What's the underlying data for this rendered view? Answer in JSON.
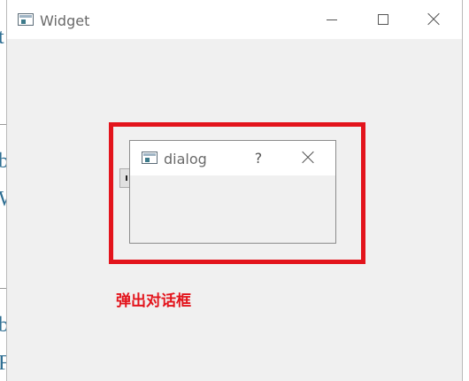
{
  "widget_window": {
    "title": "Widget",
    "icon": "app-window-icon"
  },
  "dialog": {
    "title": "dialog",
    "help_label": "?",
    "icon": "app-window-icon"
  },
  "annotation": {
    "text": "弹出对话框",
    "color": "#e3141c"
  },
  "background_glyphs": [
    "t",
    "b",
    "W",
    "b",
    "F"
  ],
  "colors": {
    "highlight": "#e3141c",
    "window_bg": "#f0f0f0",
    "titlebar_bg": "#ffffff"
  }
}
